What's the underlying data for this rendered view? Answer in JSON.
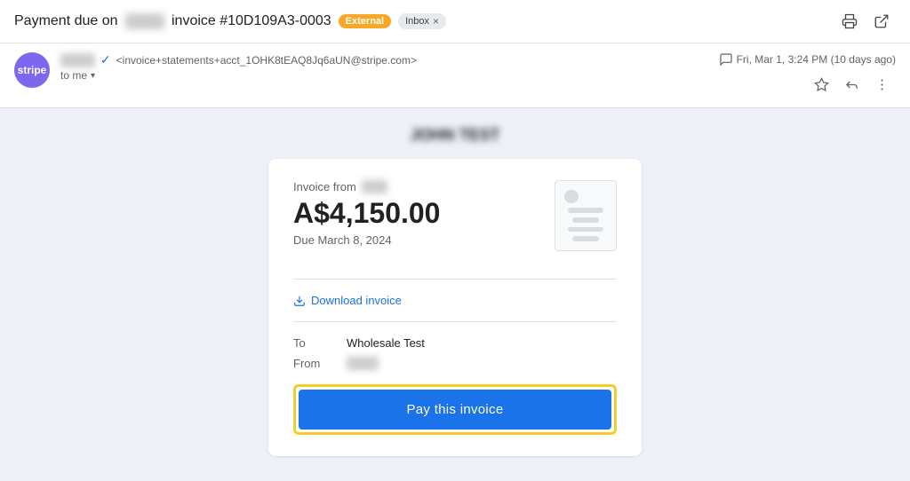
{
  "header": {
    "subject_prefix": "Payment due on",
    "subject_blurred": "JOHN TEST",
    "subject_suffix": "invoice #10D109A3-0003",
    "badge_external": "External",
    "badge_inbox": "Inbox",
    "badge_close": "×",
    "print_icon": "🖨",
    "open_icon": "⧉"
  },
  "sender": {
    "avatar_text": "stripe",
    "name_blurred": "STRIPE TEST",
    "verified_symbol": "✓",
    "email": "<invoice+statements+acct_1OHK8tEAQ8Jq6aUN@stripe.com>",
    "to_label": "to me",
    "timestamp": "Fri, Mar 1, 3:24 PM (10 days ago)",
    "star_icon": "☆",
    "reply_icon": "↩",
    "more_icon": "⋮",
    "chat_icon": "💬"
  },
  "email_body": {
    "company_name": "JOHN TEST"
  },
  "invoice": {
    "from_label": "Invoice from",
    "from_blurred": "JOHN TEST",
    "amount": "A$4,150.00",
    "due_date": "Due March 8, 2024",
    "download_label": "Download invoice",
    "to_label": "To",
    "to_value": "Wholesale Test",
    "from_field_label": "From",
    "from_field_blurred": "JOHN TEST",
    "pay_button_label": "Pay this invoice"
  }
}
